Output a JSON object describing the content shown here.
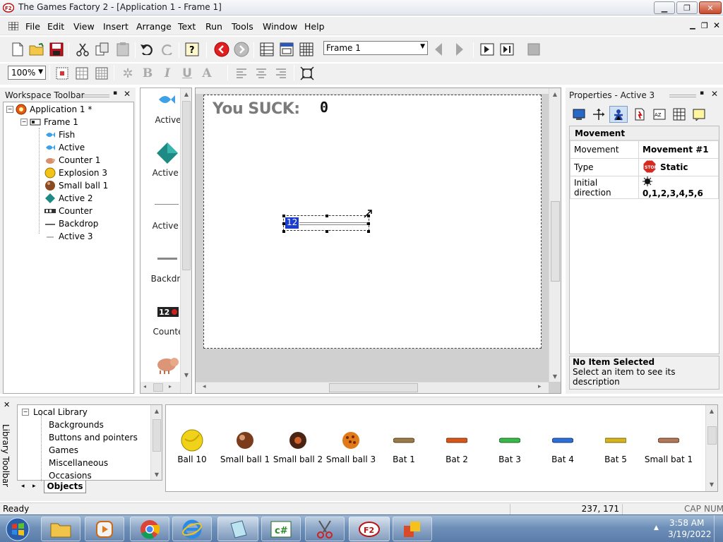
{
  "window": {
    "title": "The Games Factory 2 - [Application 1 - Frame 1]"
  },
  "menu": [
    "File",
    "Edit",
    "View",
    "Insert",
    "Arrange",
    "Text",
    "Run",
    "Tools",
    "Window",
    "Help"
  ],
  "toolbar": {
    "frame_select": "Frame 1"
  },
  "zoom": "100%",
  "workspace": {
    "title": "Workspace Toolbar",
    "app": "Application 1 *",
    "frame": "Frame 1",
    "objects": [
      "Fish",
      "Active",
      "Counter 1",
      "Explosion 3",
      "Small ball 1",
      "Active 2",
      "Counter",
      "Backdrop",
      "Active 3"
    ]
  },
  "object_column": [
    "Active",
    "Active .",
    "Active .",
    "Backdro",
    "Counte"
  ],
  "frame_editor": {
    "text": "You SUCK:",
    "score": "0",
    "counter_value": "12"
  },
  "properties": {
    "title": "Properties - Active 3",
    "section": "Movement",
    "rows": [
      {
        "label": "Movement",
        "value": "Movement #1"
      },
      {
        "label": "Type",
        "value": "Static"
      },
      {
        "label": "Initial direction",
        "value": "0,1,2,3,4,5,6"
      }
    ],
    "desc_title": "No Item Selected",
    "desc_text": "Select an item to see its description"
  },
  "library": {
    "side_label": "Library Toolbar",
    "root": "Local Library",
    "folders": [
      "Backgrounds",
      "Buttons and pointers",
      "Games",
      "Miscellaneous",
      "Occasions"
    ],
    "tab": "Objects",
    "items": [
      "Ball 10",
      "Small ball 1",
      "Small ball 2",
      "Small ball 3",
      "Bat 1",
      "Bat 2",
      "Bat 3",
      "Bat 4",
      "Bat 5",
      "Small bat 1"
    ]
  },
  "status": {
    "text": "Ready",
    "coords": "237, 171",
    "cap": "CAP",
    "num": "NUM"
  },
  "clock": {
    "time": "3:58 AM",
    "date": "3/19/2022"
  }
}
